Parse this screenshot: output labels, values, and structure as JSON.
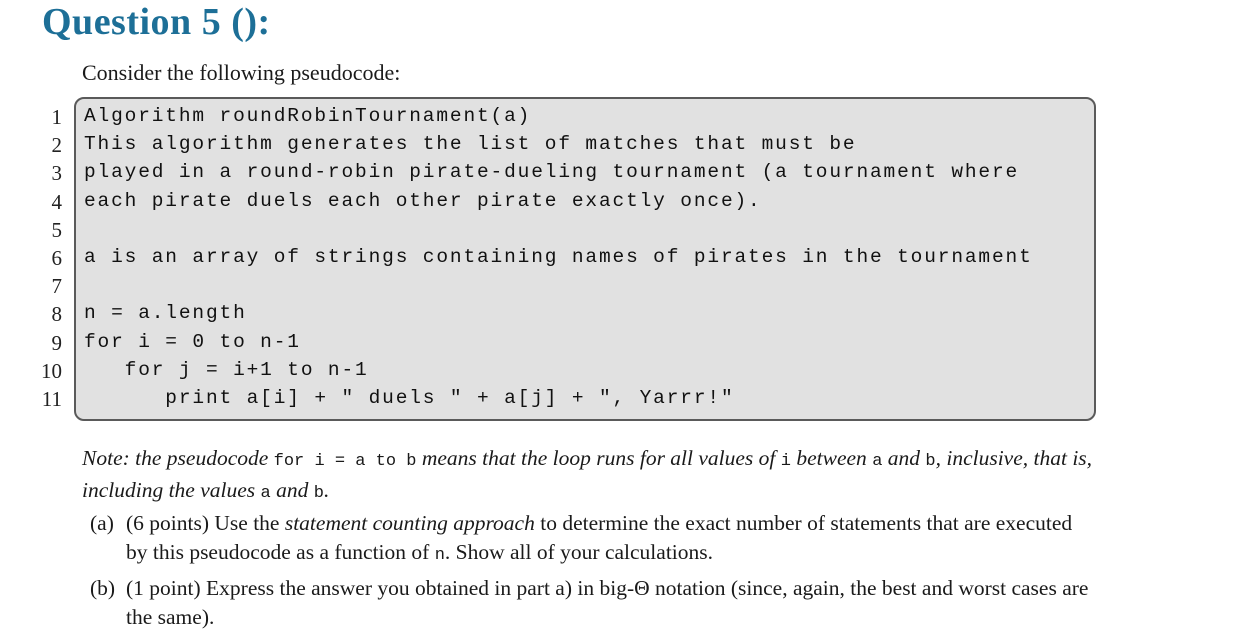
{
  "title": "Question 5 ():",
  "intro": "Consider the following pseudocode:",
  "code_lines": [
    {
      "num": "1",
      "text": "Algorithm roundRobinTournament(a)"
    },
    {
      "num": "2",
      "text": "This algorithm generates the list of matches that must be"
    },
    {
      "num": "3",
      "text": "played in a round-robin pirate-dueling tournament (a tournament where"
    },
    {
      "num": "4",
      "text": "each pirate duels each other pirate exactly once)."
    },
    {
      "num": "5",
      "text": ""
    },
    {
      "num": "6",
      "text": "a is an array of strings containing names of pirates in the tournament"
    },
    {
      "num": "7",
      "text": ""
    },
    {
      "num": "8",
      "text": "n = a.length"
    },
    {
      "num": "9",
      "text": "for i = 0 to n-1"
    },
    {
      "num": "10",
      "text": "   for j = i+1 to n-1"
    },
    {
      "num": "11",
      "text": "      print a[i] + \" duels \" + a[j] + \", Yarrr!\""
    }
  ],
  "note": {
    "p1": "Note: the pseudocode ",
    "c1": "for i = a to b",
    "p2": " means that the loop runs for all values of ",
    "c2": "i",
    "p3": " between ",
    "c3": "a",
    "p4": " and ",
    "c4": "b",
    "p5": ", inclusive, that is, including the values ",
    "c5": "a",
    "p6": " and ",
    "c6": "b",
    "p7": "."
  },
  "parts": [
    {
      "label": "(a)",
      "points": "(6 points)",
      "t1": " Use the ",
      "em": "statement counting approach",
      "t2": " to determine the exact number of statements that are executed by this pseudocode as a function of ",
      "code": "n",
      "t3": ". Show all of your calculations."
    },
    {
      "label": "(b)",
      "points": "(1 point)",
      "t1": " Express the answer you obtained in part a) in big-Θ notation (since, again, the best and worst cases are the same)."
    }
  ]
}
